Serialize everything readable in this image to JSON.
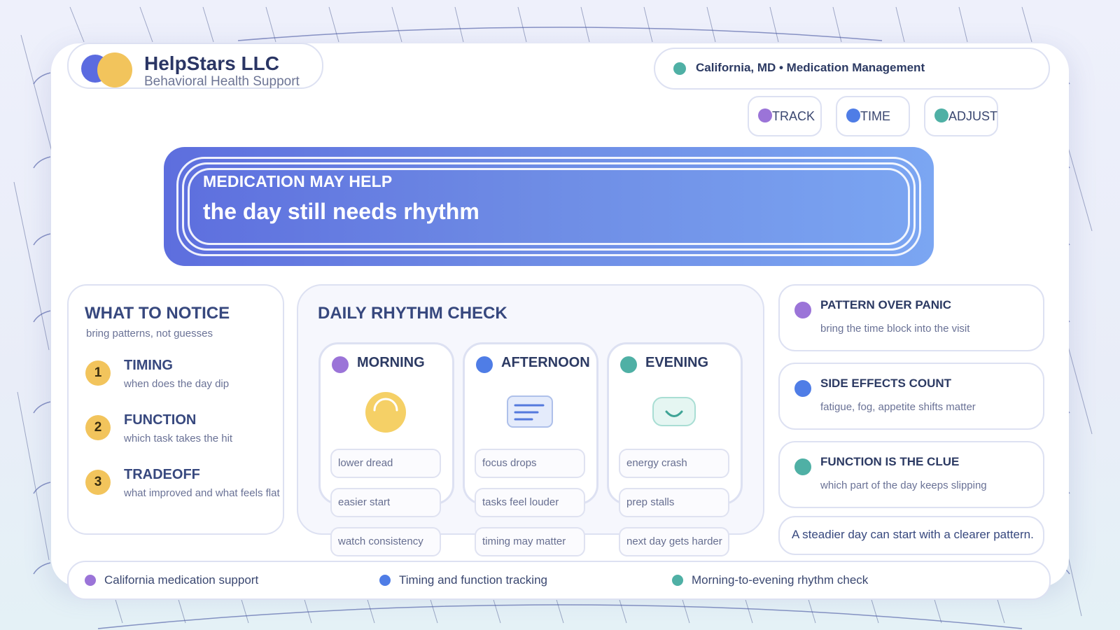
{
  "brand": {
    "name": "HelpStars LLC",
    "tagline": "Behavioral Health Support"
  },
  "location": {
    "text": "California, MD • Medication Management",
    "dot_color": "#4fb0a5"
  },
  "tags": [
    {
      "label": "TRACK",
      "color": "#9b74d8"
    },
    {
      "label": "TIME",
      "color": "#4f7de6"
    },
    {
      "label": "ADJUST",
      "color": "#4fb0a5"
    }
  ],
  "hero": {
    "kicker": "MEDICATION MAY HELP",
    "title": "the day still needs rhythm"
  },
  "notice": {
    "title": "WHAT TO NOTICE",
    "subtitle": "bring patterns, not guesses",
    "steps": [
      {
        "num": "1",
        "title": "TIMING",
        "desc": "when does the day dip"
      },
      {
        "num": "2",
        "title": "FUNCTION",
        "desc": "which task takes the hit"
      },
      {
        "num": "3",
        "title": "TRADEOFF",
        "desc": "what improved and what feels flat"
      }
    ]
  },
  "rhythm": {
    "title": "DAILY RHYTHM CHECK",
    "columns": [
      {
        "label": "MORNING",
        "color": "#9b74d8",
        "icon": "sun-icon",
        "chips": [
          "lower dread",
          "easier start",
          "watch consistency"
        ]
      },
      {
        "label": "AFTERNOON",
        "color": "#4f7de6",
        "icon": "notes-icon",
        "chips": [
          "focus drops",
          "tasks feel louder",
          "timing may matter"
        ]
      },
      {
        "label": "EVENING",
        "color": "#4fb0a5",
        "icon": "smile-icon",
        "chips": [
          "energy crash",
          "prep stalls",
          "next day gets harder"
        ]
      }
    ]
  },
  "cards": [
    {
      "title": "PATTERN OVER PANIC",
      "desc": "bring the time block into the visit",
      "color": "#9b74d8"
    },
    {
      "title": "SIDE EFFECTS COUNT",
      "desc": "fatigue, fog, appetite shifts matter",
      "color": "#4f7de6"
    },
    {
      "title": "FUNCTION IS THE CLUE",
      "desc": "which part of the day keeps slipping",
      "color": "#4fb0a5"
    }
  ],
  "quote": "A steadier day can start with a clearer pattern.",
  "footer": [
    {
      "label": "California medication support",
      "color": "#9b74d8"
    },
    {
      "label": "Timing and function tracking",
      "color": "#4f7de6"
    },
    {
      "label": "Morning-to-evening rhythm check",
      "color": "#4fb0a5"
    }
  ]
}
